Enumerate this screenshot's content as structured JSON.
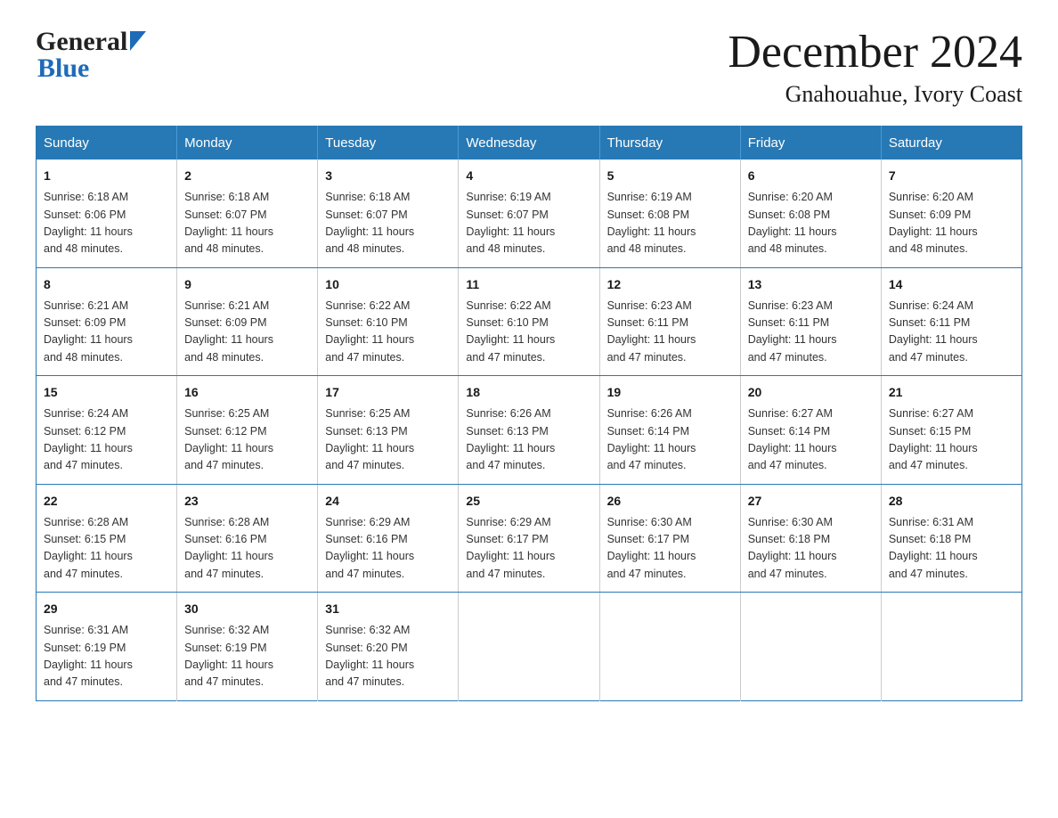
{
  "header": {
    "month_year": "December 2024",
    "location": "Gnahouahue, Ivory Coast",
    "logo_general": "General",
    "logo_blue": "Blue"
  },
  "days_of_week": [
    "Sunday",
    "Monday",
    "Tuesday",
    "Wednesday",
    "Thursday",
    "Friday",
    "Saturday"
  ],
  "weeks": [
    [
      {
        "day": "1",
        "sunrise": "6:18 AM",
        "sunset": "6:06 PM",
        "daylight": "11 hours and 48 minutes."
      },
      {
        "day": "2",
        "sunrise": "6:18 AM",
        "sunset": "6:07 PM",
        "daylight": "11 hours and 48 minutes."
      },
      {
        "day": "3",
        "sunrise": "6:18 AM",
        "sunset": "6:07 PM",
        "daylight": "11 hours and 48 minutes."
      },
      {
        "day": "4",
        "sunrise": "6:19 AM",
        "sunset": "6:07 PM",
        "daylight": "11 hours and 48 minutes."
      },
      {
        "day": "5",
        "sunrise": "6:19 AM",
        "sunset": "6:08 PM",
        "daylight": "11 hours and 48 minutes."
      },
      {
        "day": "6",
        "sunrise": "6:20 AM",
        "sunset": "6:08 PM",
        "daylight": "11 hours and 48 minutes."
      },
      {
        "day": "7",
        "sunrise": "6:20 AM",
        "sunset": "6:09 PM",
        "daylight": "11 hours and 48 minutes."
      }
    ],
    [
      {
        "day": "8",
        "sunrise": "6:21 AM",
        "sunset": "6:09 PM",
        "daylight": "11 hours and 48 minutes."
      },
      {
        "day": "9",
        "sunrise": "6:21 AM",
        "sunset": "6:09 PM",
        "daylight": "11 hours and 48 minutes."
      },
      {
        "day": "10",
        "sunrise": "6:22 AM",
        "sunset": "6:10 PM",
        "daylight": "11 hours and 47 minutes."
      },
      {
        "day": "11",
        "sunrise": "6:22 AM",
        "sunset": "6:10 PM",
        "daylight": "11 hours and 47 minutes."
      },
      {
        "day": "12",
        "sunrise": "6:23 AM",
        "sunset": "6:11 PM",
        "daylight": "11 hours and 47 minutes."
      },
      {
        "day": "13",
        "sunrise": "6:23 AM",
        "sunset": "6:11 PM",
        "daylight": "11 hours and 47 minutes."
      },
      {
        "day": "14",
        "sunrise": "6:24 AM",
        "sunset": "6:11 PM",
        "daylight": "11 hours and 47 minutes."
      }
    ],
    [
      {
        "day": "15",
        "sunrise": "6:24 AM",
        "sunset": "6:12 PM",
        "daylight": "11 hours and 47 minutes."
      },
      {
        "day": "16",
        "sunrise": "6:25 AM",
        "sunset": "6:12 PM",
        "daylight": "11 hours and 47 minutes."
      },
      {
        "day": "17",
        "sunrise": "6:25 AM",
        "sunset": "6:13 PM",
        "daylight": "11 hours and 47 minutes."
      },
      {
        "day": "18",
        "sunrise": "6:26 AM",
        "sunset": "6:13 PM",
        "daylight": "11 hours and 47 minutes."
      },
      {
        "day": "19",
        "sunrise": "6:26 AM",
        "sunset": "6:14 PM",
        "daylight": "11 hours and 47 minutes."
      },
      {
        "day": "20",
        "sunrise": "6:27 AM",
        "sunset": "6:14 PM",
        "daylight": "11 hours and 47 minutes."
      },
      {
        "day": "21",
        "sunrise": "6:27 AM",
        "sunset": "6:15 PM",
        "daylight": "11 hours and 47 minutes."
      }
    ],
    [
      {
        "day": "22",
        "sunrise": "6:28 AM",
        "sunset": "6:15 PM",
        "daylight": "11 hours and 47 minutes."
      },
      {
        "day": "23",
        "sunrise": "6:28 AM",
        "sunset": "6:16 PM",
        "daylight": "11 hours and 47 minutes."
      },
      {
        "day": "24",
        "sunrise": "6:29 AM",
        "sunset": "6:16 PM",
        "daylight": "11 hours and 47 minutes."
      },
      {
        "day": "25",
        "sunrise": "6:29 AM",
        "sunset": "6:17 PM",
        "daylight": "11 hours and 47 minutes."
      },
      {
        "day": "26",
        "sunrise": "6:30 AM",
        "sunset": "6:17 PM",
        "daylight": "11 hours and 47 minutes."
      },
      {
        "day": "27",
        "sunrise": "6:30 AM",
        "sunset": "6:18 PM",
        "daylight": "11 hours and 47 minutes."
      },
      {
        "day": "28",
        "sunrise": "6:31 AM",
        "sunset": "6:18 PM",
        "daylight": "11 hours and 47 minutes."
      }
    ],
    [
      {
        "day": "29",
        "sunrise": "6:31 AM",
        "sunset": "6:19 PM",
        "daylight": "11 hours and 47 minutes."
      },
      {
        "day": "30",
        "sunrise": "6:32 AM",
        "sunset": "6:19 PM",
        "daylight": "11 hours and 47 minutes."
      },
      {
        "day": "31",
        "sunrise": "6:32 AM",
        "sunset": "6:20 PM",
        "daylight": "11 hours and 47 minutes."
      },
      null,
      null,
      null,
      null
    ]
  ],
  "labels": {
    "sunrise": "Sunrise:",
    "sunset": "Sunset:",
    "daylight": "Daylight:"
  }
}
